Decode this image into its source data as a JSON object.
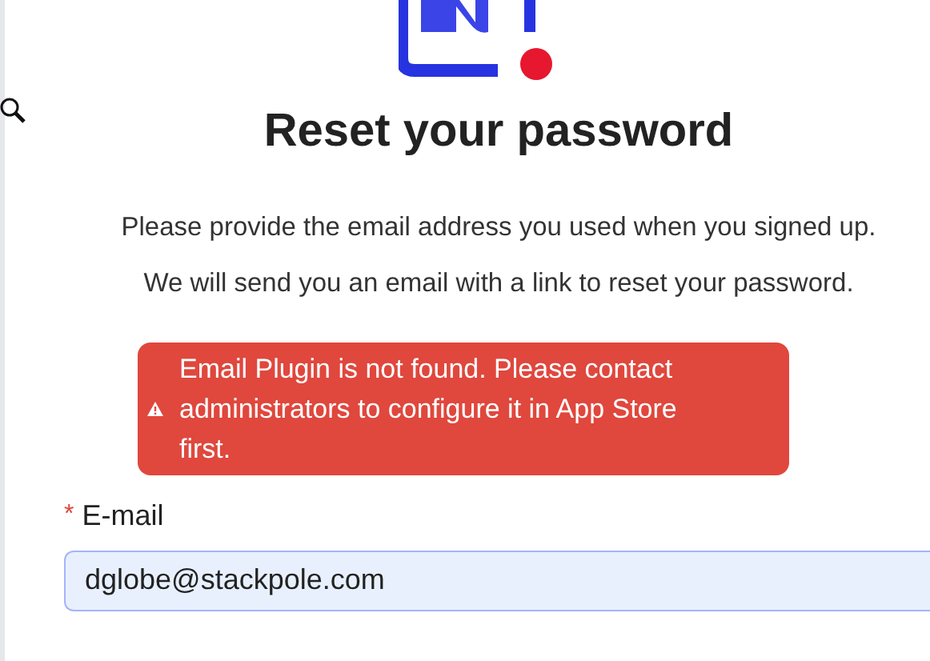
{
  "title": "Reset your password",
  "instructions": [
    "Please provide the email address you used when you signed up.",
    "We will send you an email with a link to reset your password."
  ],
  "alert": {
    "message": "Email Plugin is not found. Please contact administrators to configure it in App Store first."
  },
  "email_field": {
    "label": "E-mail",
    "required": true,
    "required_marker": "*",
    "value": "dglobe@stackpole.com"
  }
}
